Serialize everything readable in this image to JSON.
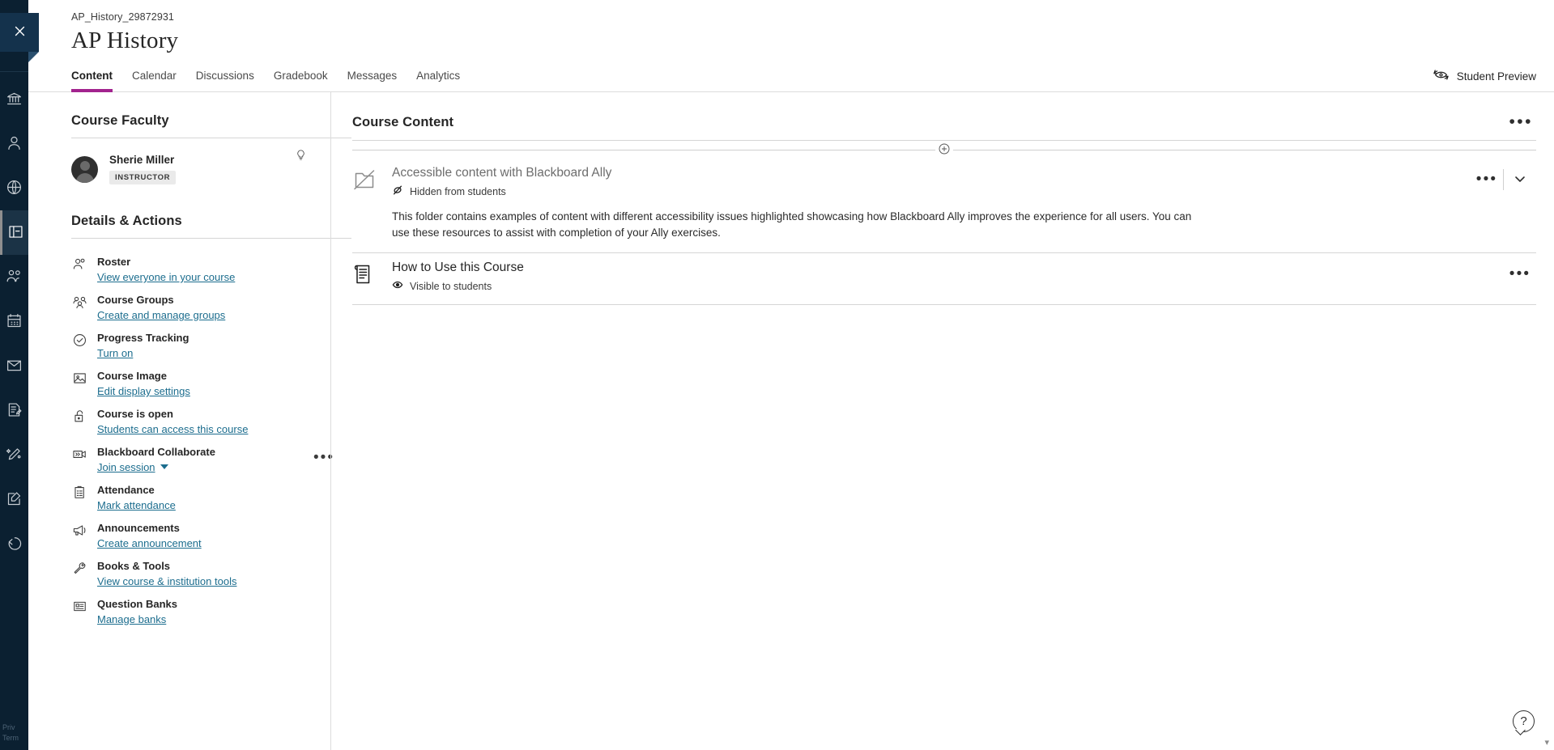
{
  "sidebar": {
    "close_label": "Close",
    "items": [
      {
        "name": "institution",
        "icon": "institution-icon"
      },
      {
        "name": "profile",
        "icon": "profile-icon"
      },
      {
        "name": "globe",
        "icon": "globe-icon"
      },
      {
        "name": "courses",
        "icon": "courses-icon",
        "active": true
      },
      {
        "name": "groups",
        "icon": "groups-icon"
      },
      {
        "name": "calendar",
        "icon": "calendar-icon"
      },
      {
        "name": "messages",
        "icon": "messages-icon"
      },
      {
        "name": "grades",
        "icon": "grades-icon"
      },
      {
        "name": "tools",
        "icon": "tools-icon"
      },
      {
        "name": "notes",
        "icon": "notes-icon"
      },
      {
        "name": "signout",
        "icon": "signout-icon"
      }
    ],
    "privacy": "Priv",
    "terms": "Term"
  },
  "header": {
    "course_id": "AP_History_29872931",
    "title": "AP History"
  },
  "tabs": [
    {
      "label": "Content",
      "active": true
    },
    {
      "label": "Calendar",
      "active": false
    },
    {
      "label": "Discussions",
      "active": false
    },
    {
      "label": "Gradebook",
      "active": false
    },
    {
      "label": "Messages",
      "active": false
    },
    {
      "label": "Analytics",
      "active": false
    }
  ],
  "student_preview": {
    "label": "Student Preview"
  },
  "faculty": {
    "heading": "Course Faculty",
    "member": {
      "name": "Sherie Miller",
      "role": "INSTRUCTOR"
    }
  },
  "details": {
    "heading": "Details & Actions",
    "items": [
      {
        "title": "Roster",
        "link": "View everyone in your course",
        "icon": "roster-icon"
      },
      {
        "title": "Course Groups",
        "link": "Create and manage groups",
        "icon": "groups-icon"
      },
      {
        "title": "Progress Tracking",
        "link": "Turn on",
        "icon": "check-circle-icon"
      },
      {
        "title": "Course Image",
        "link": "Edit display settings",
        "icon": "image-icon"
      },
      {
        "title": "Course is open",
        "link": "Students can access this course",
        "icon": "unlock-icon"
      },
      {
        "title": "Blackboard Collaborate",
        "link": "Join session",
        "icon": "video-icon",
        "has_caret": true,
        "has_menu": true
      },
      {
        "title": "Attendance",
        "link": "Mark attendance",
        "icon": "clipboard-icon"
      },
      {
        "title": "Announcements",
        "link": "Create announcement",
        "icon": "megaphone-icon"
      },
      {
        "title": "Books & Tools",
        "link": "View course & institution tools",
        "icon": "wrench-icon"
      },
      {
        "title": "Question Banks",
        "link": "Manage banks",
        "icon": "question-bank-icon"
      }
    ]
  },
  "content": {
    "heading": "Course Content",
    "add_label": "Add content",
    "items": [
      {
        "title": "Accessible content with Blackboard Ally",
        "status": "Hidden from students",
        "status_icon": "hidden-icon",
        "icon": "folder-hidden-icon",
        "muted": true,
        "description": "This folder contains examples of content with different accessibility issues highlighted showcasing how Blackboard Ally improves the experience for all users. You can use these resources to assist with completion of your Ally exercises.",
        "has_expand": true
      },
      {
        "title": "How to Use this Course",
        "status": "Visible to students",
        "status_icon": "visible-icon",
        "icon": "document-icon",
        "muted": false,
        "description": "",
        "has_expand": false
      }
    ]
  },
  "help": {
    "label": "?"
  },
  "colors": {
    "accent": "#a2238e",
    "link": "#1c6d8e",
    "rail": "#0b2031",
    "rail_active": "#1b3346"
  }
}
